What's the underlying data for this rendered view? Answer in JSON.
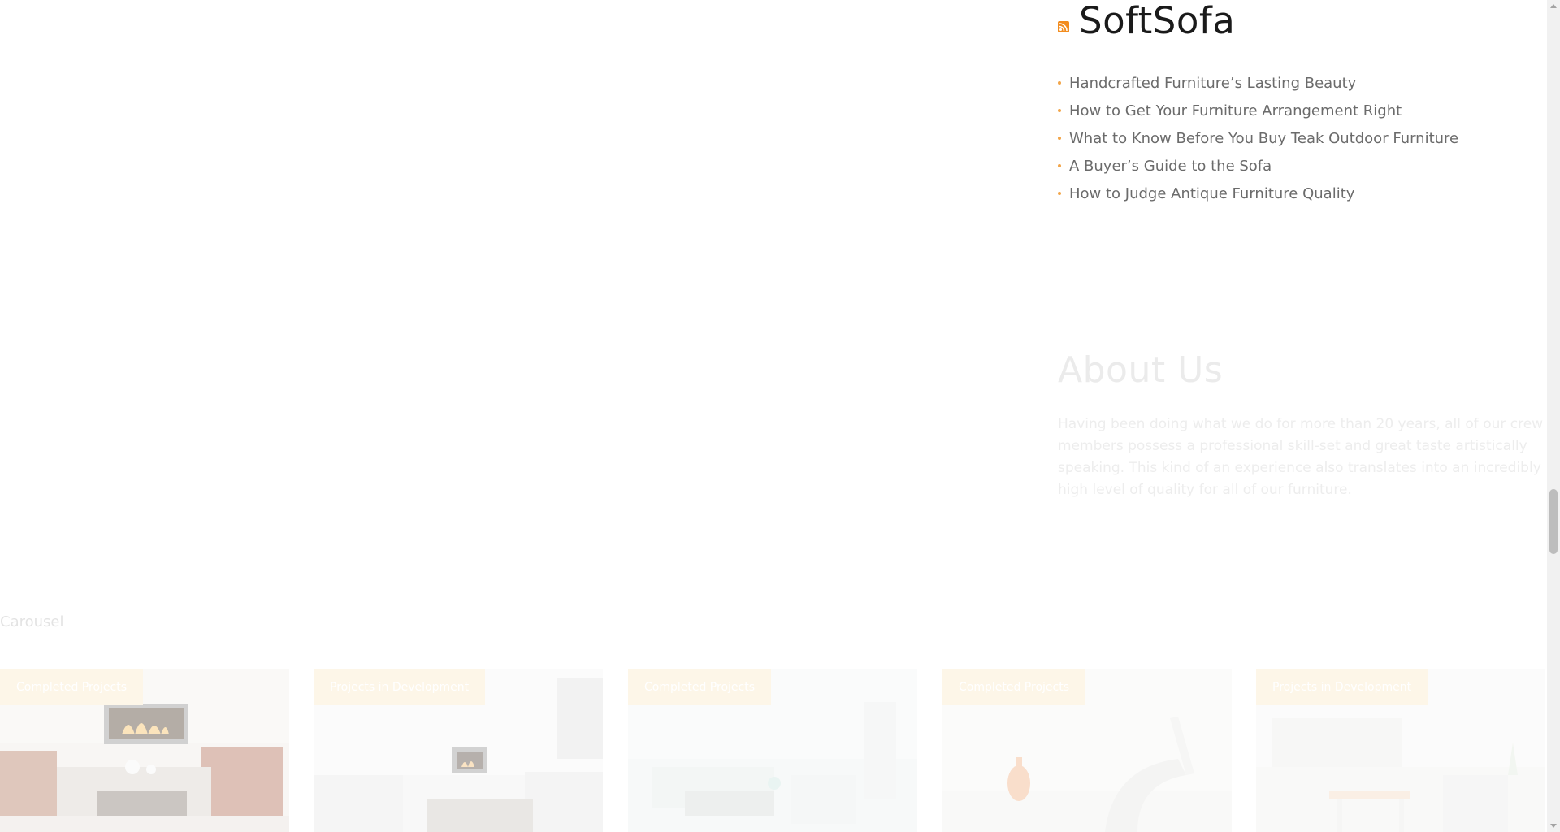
{
  "rss": {
    "icon": "rss-icon",
    "title": "SoftSofa",
    "items": [
      {
        "label": "Handcrafted Furniture’s Lasting Beauty"
      },
      {
        "label": "How to Get Your Furniture Arrangement Right"
      },
      {
        "label": "What to Know Before You Buy Teak Outdoor Furniture"
      },
      {
        "label": "A Buyer’s Guide to the Sofa"
      },
      {
        "label": "How to Judge Antique Furniture Quality"
      }
    ]
  },
  "about": {
    "title": "About Us",
    "text": "Having been doing what we do for more than 20 years, all of our crew members possess a professional skill-set and great taste artistically speaking. This kind of an experience also translates into an incredibly high level of quality for all of our furniture."
  },
  "carousel": {
    "label": "Carousel",
    "cards": [
      {
        "badge": "Completed Projects"
      },
      {
        "badge": "Projects in Development"
      },
      {
        "badge": "Completed Projects"
      },
      {
        "badge": "Completed Projects"
      },
      {
        "badge": "Projects in Development"
      }
    ]
  },
  "colors": {
    "accent": "#f28c1e",
    "bullet": "#f2a64b",
    "link": "#6b6b6b",
    "title": "#1a1a1a"
  }
}
